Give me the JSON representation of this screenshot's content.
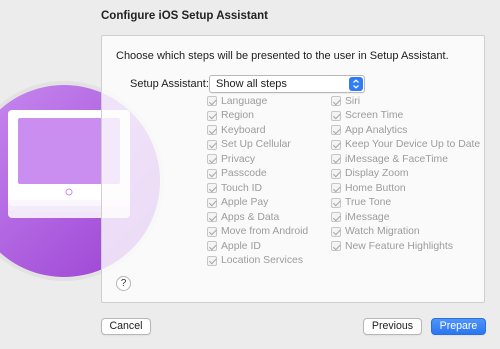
{
  "title": "Configure iOS Setup Assistant",
  "intro": "Choose which steps will be presented to the user in Setup Assistant.",
  "setup_assistant": {
    "label": "Setup Assistant:",
    "selected": "Show all steps"
  },
  "steps_col1": [
    {
      "label": "Language",
      "checked": true
    },
    {
      "label": "Region",
      "checked": true
    },
    {
      "label": "Keyboard",
      "checked": true
    },
    {
      "label": "Set Up Cellular",
      "checked": true
    },
    {
      "label": "Privacy",
      "checked": true
    },
    {
      "label": "Passcode",
      "checked": true
    },
    {
      "label": "Touch ID",
      "checked": true
    },
    {
      "label": "Apple Pay",
      "checked": true
    },
    {
      "label": "Apps & Data",
      "checked": true
    },
    {
      "label": "Move from Android",
      "checked": true
    },
    {
      "label": "Apple ID",
      "checked": true
    },
    {
      "label": "Location Services",
      "checked": true
    }
  ],
  "steps_col2": [
    {
      "label": "Siri",
      "checked": true
    },
    {
      "label": "Screen Time",
      "checked": true
    },
    {
      "label": "App Analytics",
      "checked": true
    },
    {
      "label": "Keep Your Device Up to Date",
      "checked": true
    },
    {
      "label": "iMessage & FaceTime",
      "checked": true
    },
    {
      "label": "Display Zoom",
      "checked": true
    },
    {
      "label": "Home Button",
      "checked": true
    },
    {
      "label": "True Tone",
      "checked": true
    },
    {
      "label": "iMessage",
      "checked": true
    },
    {
      "label": "Watch Migration",
      "checked": true
    },
    {
      "label": "New Feature Highlights",
      "checked": true
    }
  ],
  "help": "?",
  "buttons": {
    "cancel": "Cancel",
    "previous": "Previous",
    "prepare": "Prepare"
  },
  "colors": {
    "accent": "#2f7cf6",
    "illustration_purple": "#b45ce6"
  },
  "icons": {
    "illustration": "ipad-stack-illustration",
    "select": "chevron-up-down-icon",
    "help": "help-icon",
    "checkbox": "checkmark-icon"
  }
}
